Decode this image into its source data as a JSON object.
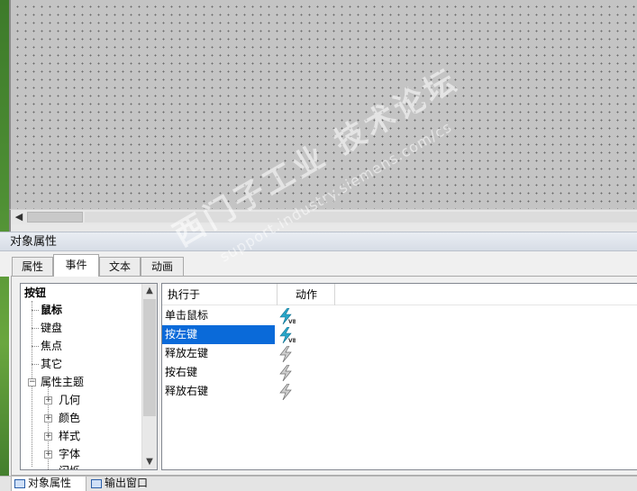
{
  "panel": {
    "title": "对象属性",
    "tabs": [
      {
        "label": "属性",
        "active": false
      },
      {
        "label": "事件",
        "active": true
      },
      {
        "label": "文本",
        "active": false
      },
      {
        "label": "动画",
        "active": false
      }
    ]
  },
  "tree": {
    "root": "按钮",
    "items": [
      {
        "label": "鼠标",
        "selected": true
      },
      {
        "label": "键盘"
      },
      {
        "label": "焦点"
      },
      {
        "label": "其它"
      },
      {
        "label": "属性主题"
      },
      {
        "label": "几何"
      },
      {
        "label": "颜色"
      },
      {
        "label": "样式"
      },
      {
        "label": "字体"
      },
      {
        "label": "闪烁"
      }
    ]
  },
  "grid": {
    "columns": [
      "执行于",
      "动作"
    ],
    "rows": [
      {
        "label": "单击鼠标",
        "has_script": true,
        "selected": false
      },
      {
        "label": "按左键",
        "has_script": true,
        "selected": true
      },
      {
        "label": "释放左键",
        "has_script": false,
        "selected": false
      },
      {
        "label": "按右键",
        "has_script": false,
        "selected": false
      },
      {
        "label": "释放右键",
        "has_script": false,
        "selected": false
      }
    ]
  },
  "icons": {
    "action_script": "lightning-vb-icon",
    "action_empty": "lightning-icon"
  },
  "bottom_tabs": [
    {
      "label": "对象属性",
      "active": true
    },
    {
      "label": "输出窗口",
      "active": false
    }
  ],
  "watermark": {
    "main": "西门子工业  技术论坛",
    "url": "support.industry.siemens.com/cs"
  },
  "colors": {
    "selection": "#0a6ad9",
    "canvas": "#c4c4c4"
  }
}
